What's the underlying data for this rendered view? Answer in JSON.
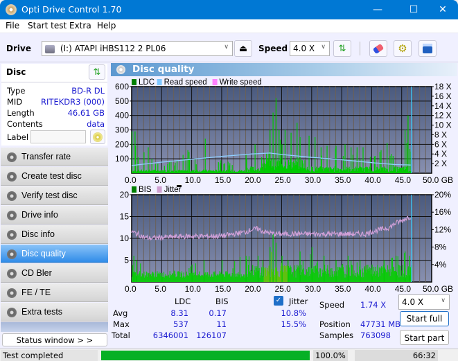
{
  "window": {
    "title": "Opti Drive Control 1.70",
    "minimize": "—",
    "maximize": "☐",
    "close": "✕"
  },
  "menu": [
    "File",
    "Start test",
    "Extra",
    "Help"
  ],
  "toolbar": {
    "drive_label": "Drive",
    "drive_value": "(I:)  ATAPI iHBS112   2 PL06",
    "speed_label": "Speed",
    "speed_value": "4.0 X"
  },
  "disc": {
    "header": "Disc",
    "rows": [
      {
        "label": "Type",
        "value": "BD-R DL"
      },
      {
        "label": "MID",
        "value": "RITEKDR3 (000)"
      },
      {
        "label": "Length",
        "value": "46.61 GB"
      },
      {
        "label": "Contents",
        "value": "data"
      },
      {
        "label": "Label",
        "value": ""
      }
    ]
  },
  "nav": [
    {
      "label": "Transfer rate",
      "active": false
    },
    {
      "label": "Create test disc",
      "active": false
    },
    {
      "label": "Verify test disc",
      "active": false
    },
    {
      "label": "Drive info",
      "active": false
    },
    {
      "label": "Disc info",
      "active": false
    },
    {
      "label": "Disc quality",
      "active": true
    },
    {
      "label": "CD Bler",
      "active": false
    },
    {
      "label": "FE / TE",
      "active": false
    },
    {
      "label": "Extra tests",
      "active": false
    }
  ],
  "status_window_label": "Status window > >",
  "panel_title": "Disc quality",
  "chart_data": [
    {
      "type": "bar",
      "title": "LDC / Read speed",
      "legend": [
        {
          "name": "LDC",
          "color": "#008000"
        },
        {
          "name": "Read speed",
          "color": "#80c8ff"
        },
        {
          "name": "Write speed",
          "color": "#ff80ff"
        }
      ],
      "x_ticks": [
        "0.0",
        "5.0",
        "10.0",
        "15.0",
        "20.0",
        "25.0",
        "30.0",
        "35.0",
        "40.0",
        "45.0",
        "50.0 GB"
      ],
      "xlim": [
        0,
        50
      ],
      "y_ticks": [
        "100",
        "200",
        "300",
        "400",
        "500",
        "600"
      ],
      "ylim": [
        0,
        600
      ],
      "y2_ticks": [
        "2 X",
        "4 X",
        "6 X",
        "8 X",
        "10 X",
        "12 X",
        "14 X",
        "16 X",
        "18 X"
      ],
      "y2lim": [
        0,
        18
      ],
      "end_marker_gb": 46.61,
      "ldc_peaks": [
        [
          0.0,
          290
        ],
        [
          0.5,
          290
        ],
        [
          1.0,
          110
        ],
        [
          2.7,
          180
        ],
        [
          3.3,
          100
        ],
        [
          7.5,
          90
        ],
        [
          9.3,
          160
        ],
        [
          10.5,
          100
        ],
        [
          12.2,
          240
        ],
        [
          14.8,
          90
        ],
        [
          16.0,
          80
        ],
        [
          19.0,
          130
        ],
        [
          20.5,
          200
        ],
        [
          22.0,
          100
        ],
        [
          23.0,
          300
        ],
        [
          23.5,
          420
        ],
        [
          24.0,
          520
        ],
        [
          24.5,
          300
        ],
        [
          25.0,
          200
        ],
        [
          25.5,
          300
        ],
        [
          26.5,
          280
        ],
        [
          27.5,
          350
        ],
        [
          28.0,
          250
        ],
        [
          29.5,
          260
        ],
        [
          30.5,
          250
        ],
        [
          31.5,
          180
        ],
        [
          32.5,
          190
        ],
        [
          34.0,
          190
        ],
        [
          35.5,
          200
        ],
        [
          36.5,
          180
        ],
        [
          37.5,
          180
        ],
        [
          38.5,
          180
        ],
        [
          40.5,
          120
        ],
        [
          41.5,
          160
        ],
        [
          42.5,
          210
        ],
        [
          43.5,
          120
        ],
        [
          45.5,
          300
        ],
        [
          46.0,
          400
        ],
        [
          46.5,
          150
        ]
      ],
      "read_speed": [
        [
          0,
          1.6
        ],
        [
          5,
          2.3
        ],
        [
          10,
          2.9
        ],
        [
          15,
          3.5
        ],
        [
          20,
          4.0
        ],
        [
          23,
          4.2
        ],
        [
          25,
          3.9
        ],
        [
          30,
          3.3
        ],
        [
          35,
          2.8
        ],
        [
          40,
          2.2
        ],
        [
          44,
          1.8
        ],
        [
          46.6,
          1.7
        ]
      ]
    },
    {
      "type": "bar",
      "title": "BIS / Jitter",
      "legend": [
        {
          "name": "BIS",
          "color": "#008000"
        },
        {
          "name": "Jitter",
          "color": "#d0a0d0"
        }
      ],
      "x_ticks": [
        "0.0",
        "5.0",
        "10.0",
        "15.0",
        "20.0",
        "25.0",
        "30.0",
        "35.0",
        "40.0",
        "45.0",
        "50.0 GB"
      ],
      "xlim": [
        0,
        50
      ],
      "y_ticks": [
        "5",
        "10",
        "15",
        "20"
      ],
      "ylim": [
        0,
        20
      ],
      "y2_ticks": [
        "4%",
        "8%",
        "12%",
        "16%",
        "20%"
      ],
      "y2lim": [
        0,
        20
      ],
      "end_marker_gb": 46.61,
      "bis_peaks": [
        [
          0.3,
          6
        ],
        [
          0.7,
          5
        ],
        [
          5,
          2
        ],
        [
          10,
          4
        ],
        [
          12,
          5
        ],
        [
          15,
          5
        ],
        [
          19,
          6
        ],
        [
          21,
          6
        ],
        [
          23,
          8
        ],
        [
          23.5,
          11
        ],
        [
          24,
          9
        ],
        [
          25,
          6
        ],
        [
          26,
          5
        ],
        [
          28,
          7
        ],
        [
          30,
          8
        ],
        [
          32,
          6
        ],
        [
          34,
          5
        ],
        [
          36,
          6
        ],
        [
          38,
          5
        ],
        [
          40,
          4
        ],
        [
          42,
          5
        ],
        [
          44,
          6
        ],
        [
          45.5,
          7
        ],
        [
          46.2,
          6
        ]
      ],
      "jitter": [
        [
          0,
          11.5
        ],
        [
          1,
          11.0
        ],
        [
          2,
          10.3
        ],
        [
          3,
          10.0
        ],
        [
          5,
          10.2
        ],
        [
          8,
          10.4
        ],
        [
          10,
          10.5
        ],
        [
          15,
          10.5
        ],
        [
          17,
          11.0
        ],
        [
          19,
          11.5
        ],
        [
          20,
          12.0
        ],
        [
          21,
          12.2
        ],
        [
          22,
          11.5
        ],
        [
          24,
          11.0
        ],
        [
          26,
          11.0
        ],
        [
          30,
          11.0
        ],
        [
          35,
          11.0
        ],
        [
          39,
          11.0
        ],
        [
          40,
          11.5
        ],
        [
          42,
          12.2
        ],
        [
          43,
          12.5
        ],
        [
          44,
          13.5
        ],
        [
          45,
          14.0
        ],
        [
          46,
          14.8
        ],
        [
          46.6,
          15.0
        ]
      ]
    }
  ],
  "stats": {
    "col_ldc": "LDC",
    "col_bis": "BIS",
    "jitter_label": "Jitter",
    "jitter_checked": true,
    "rows": [
      {
        "label": "Avg",
        "ldc": "8.31",
        "bis": "0.17",
        "jitter": "10.8%"
      },
      {
        "label": "Max",
        "ldc": "537",
        "bis": "11",
        "jitter": "15.5%"
      },
      {
        "label": "Total",
        "ldc": "6346001",
        "bis": "126107",
        "jitter": ""
      }
    ],
    "speed_label": "Speed",
    "speed_value": "1.74 X",
    "position_label": "Position",
    "position_value": "47731 MB",
    "samples_label": "Samples",
    "samples_value": "763098",
    "speed_select": "4.0 X",
    "start_full": "Start full",
    "start_part": "Start part"
  },
  "statusbar": {
    "text": "Test completed",
    "progress_percent": 100,
    "progress_text": "100.0%",
    "elapsed": "66:32"
  }
}
